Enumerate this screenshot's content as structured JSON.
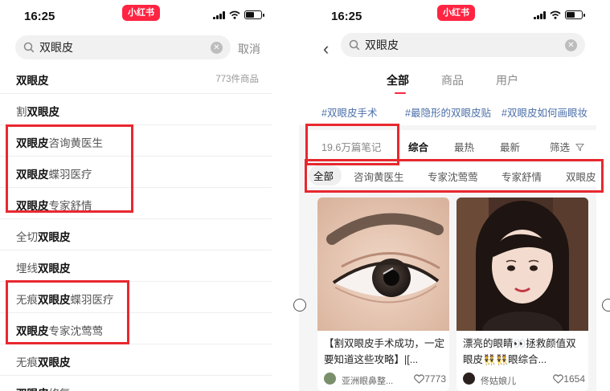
{
  "left": {
    "status": {
      "time": "16:25",
      "brand": "小红书"
    },
    "search": {
      "query": "双眼皮",
      "cancel": "取消"
    },
    "suggestions": [
      {
        "pre": "",
        "key": "双眼皮",
        "post": "",
        "count": "773件商品"
      },
      {
        "pre": "割",
        "key": "双眼皮",
        "post": "",
        "count": ""
      },
      {
        "pre": "",
        "key": "双眼皮",
        "post": "咨询黄医生",
        "count": ""
      },
      {
        "pre": "",
        "key": "双眼皮",
        "post": "蝶羽医疗",
        "count": ""
      },
      {
        "pre": "",
        "key": "双眼皮",
        "post": "专家舒情",
        "count": ""
      },
      {
        "pre": "全切",
        "key": "双眼皮",
        "post": "",
        "count": ""
      },
      {
        "pre": "埋线",
        "key": "双眼皮",
        "post": "",
        "count": ""
      },
      {
        "pre": "无痕",
        "key": "双眼皮",
        "post": "蝶羽医疗",
        "count": ""
      },
      {
        "pre": "",
        "key": "双眼皮",
        "post": "专家沈莺莺",
        "count": ""
      },
      {
        "pre": "无痕",
        "key": "双眼皮",
        "post": "",
        "count": ""
      },
      {
        "pre": "",
        "key": "双眼皮",
        "post": "修复",
        "count": ""
      }
    ]
  },
  "right": {
    "status": {
      "time": "16:25",
      "brand": "小红书"
    },
    "search": {
      "query": "双眼皮"
    },
    "tabs": [
      "全部",
      "商品",
      "用户"
    ],
    "tags": [
      "#双眼皮手术",
      "#最隐形的双眼皮贴",
      "#双眼皮如何画眼妆"
    ],
    "sort": {
      "notes": "19.6万篇笔记",
      "options": [
        "综合",
        "最热",
        "最新"
      ],
      "filter": "筛选"
    },
    "filters": [
      "全部",
      "咨询黄医生",
      "专家沈莺莺",
      "专家舒情",
      "双眼皮"
    ],
    "cards": [
      {
        "title": "【割双眼皮手术成功，一定要知道这些攻略】|[...",
        "author": "亚洲眼鼻整...",
        "likes": "7773"
      },
      {
        "title": "漂亮的眼睛👀拯救颜值双眼皮👯👯眼综合...",
        "author": "佟姑娘儿",
        "likes": "1654"
      }
    ]
  },
  "colors": {
    "accent": "#ff2442",
    "highlight_box": "#e8282f",
    "tag_link": "#4b6fa8"
  }
}
